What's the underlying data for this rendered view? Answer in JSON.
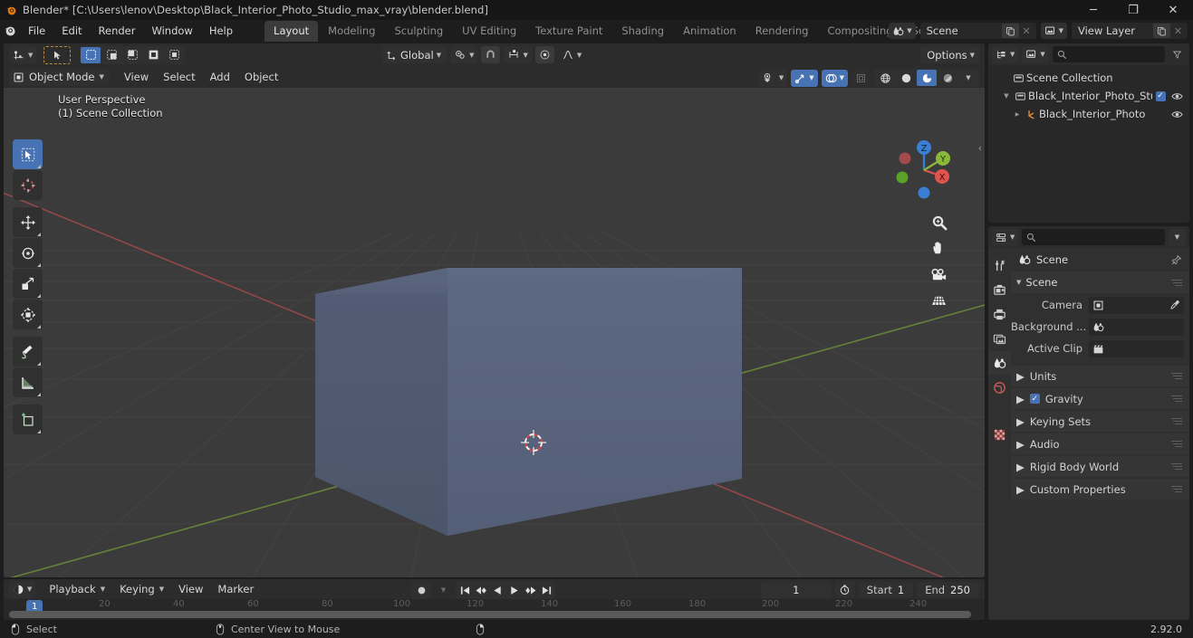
{
  "window": {
    "title": "Blender* [C:\\Users\\lenov\\Desktop\\Black_Interior_Photo_Studio_max_vray\\blender.blend]",
    "minimize": "─",
    "maximize": "❐",
    "close": "✕"
  },
  "topbar": {
    "menus": [
      "File",
      "Edit",
      "Render",
      "Window",
      "Help"
    ],
    "workspaces": [
      {
        "label": "Layout",
        "active": true
      },
      {
        "label": "Modeling",
        "active": false
      },
      {
        "label": "Sculpting",
        "active": false
      },
      {
        "label": "UV Editing",
        "active": false
      },
      {
        "label": "Texture Paint",
        "active": false
      },
      {
        "label": "Shading",
        "active": false
      },
      {
        "label": "Animation",
        "active": false
      },
      {
        "label": "Rendering",
        "active": false
      },
      {
        "label": "Compositing",
        "active": false
      },
      {
        "label": "Scripting",
        "active": false
      }
    ],
    "add_workspace": "+",
    "scene_name": "Scene",
    "view_layer_name": "View Layer"
  },
  "viewport": {
    "mode": "Object Mode",
    "menus": [
      "View",
      "Select",
      "Add",
      "Object"
    ],
    "transform_orientation": "Global",
    "options_label": "Options",
    "overlay_text_line1": "User Perspective",
    "overlay_text_line2": "(1) Scene Collection",
    "gizmo_axes": {
      "x": "X",
      "y": "Y",
      "z": "Z"
    },
    "tools": [
      "select-box-tool",
      "cursor-tool",
      "move-tool",
      "rotate-tool",
      "scale-tool",
      "transform-tool",
      "annotate-tool",
      "measure-tool",
      "add-cube-tool"
    ]
  },
  "outliner": {
    "search_placeholder": "",
    "rows": [
      {
        "name": "Scene Collection",
        "indent": 0,
        "disclosure": "",
        "icon": "collection-icon",
        "checkbox": false,
        "eye": false
      },
      {
        "name": "Black_Interior_Photo_Stu",
        "indent": 1,
        "disclosure": "▼",
        "icon": "collection-icon",
        "checkbox": true,
        "eye": true
      },
      {
        "name": "Black_Interior_Photo",
        "indent": 2,
        "disclosure": "▶",
        "icon": "mesh-icon",
        "checkbox": false,
        "eye": true
      }
    ]
  },
  "properties": {
    "search_placeholder": "",
    "breadcrumb": "Scene",
    "panel_title": "Scene",
    "rows": [
      {
        "label": "Camera",
        "value": "",
        "icon": "camera-icon"
      },
      {
        "label": "Background ...",
        "value": "",
        "icon": "scene-icon"
      },
      {
        "label": "Active Clip",
        "value": "",
        "icon": "clip-icon"
      }
    ],
    "closed_panels": [
      {
        "label": "Units",
        "checkbox": false
      },
      {
        "label": "Gravity",
        "checkbox": true
      },
      {
        "label": "Keying Sets",
        "checkbox": false
      },
      {
        "label": "Audio",
        "checkbox": false
      },
      {
        "label": "Rigid Body World",
        "checkbox": false
      },
      {
        "label": "Custom Properties",
        "checkbox": false
      }
    ],
    "tabs": [
      "tool-tab",
      "render-tab",
      "output-tab",
      "view-layer-tab",
      "scene-tab",
      "world-tab",
      "texture-tab"
    ]
  },
  "timeline": {
    "menus": [
      "Playback",
      "Keying",
      "View",
      "Marker"
    ],
    "current_frame": "1",
    "start_label": "Start",
    "start_value": "1",
    "end_label": "End",
    "end_value": "250",
    "ticks": [
      "20",
      "40",
      "60",
      "80",
      "100",
      "120",
      "140",
      "160",
      "180",
      "200",
      "220",
      "240"
    ],
    "playhead_label": "1"
  },
  "statusbar": {
    "items": [
      {
        "icon": "mouse-left-icon",
        "label": "Select"
      },
      {
        "icon": "mouse-middle-icon",
        "label": "Center View to Mouse"
      },
      {
        "icon": "mouse-right-icon",
        "label": ""
      }
    ],
    "version": "2.92.0"
  },
  "colors": {
    "accent": "#4772b3",
    "axis_x": "#e0534f",
    "axis_y": "#8ab83a",
    "axis_z": "#3b7fd4",
    "window_bg": "#1d1d1d",
    "panel_bg": "#282828",
    "header_bg": "#2c2c2c",
    "viewport_bg": "#3b3b3b",
    "cube_fill": "#56617a"
  }
}
